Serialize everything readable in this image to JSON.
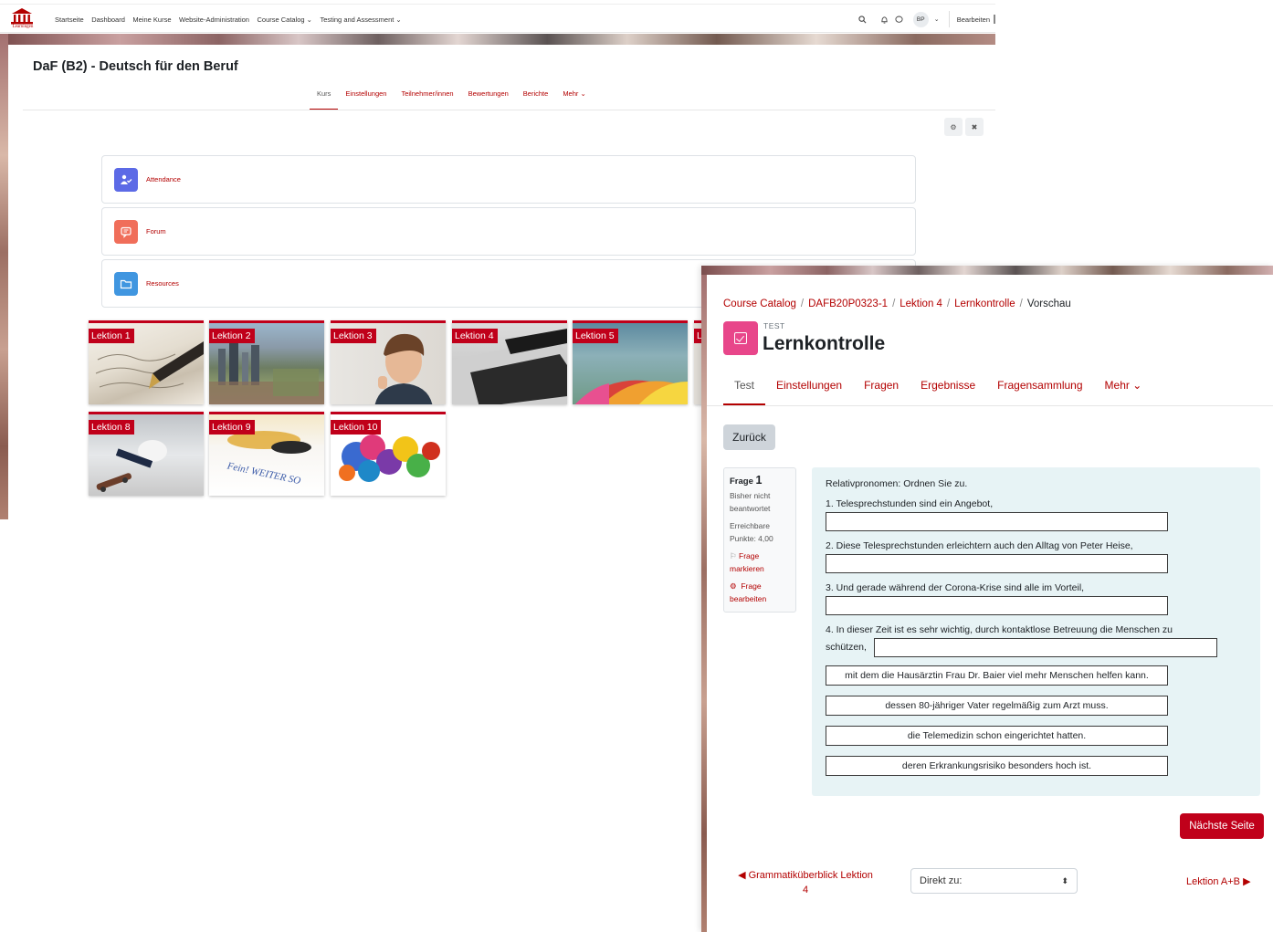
{
  "back_window": {
    "nav": {
      "logo_text": "Learningen",
      "links": [
        "Startseite",
        "Dashboard",
        "Meine Kurse",
        "Website-Administration",
        "Course Catalog ⌄",
        "Testing and Assessment ⌄"
      ],
      "avatar": "BP",
      "edit_label": "Bearbeiten"
    },
    "course_title": "DaF (B2) - Deutsch für den Beruf",
    "course_tabs": [
      "Kurs",
      "Einstellungen",
      "Teilnehmer/innen",
      "Bewertungen",
      "Berichte",
      "Mehr ⌄"
    ],
    "activities": [
      {
        "label": "Attendance",
        "icon": "attendance-icon",
        "color": "#5c6ae6"
      },
      {
        "label": "Forum",
        "icon": "forum-icon",
        "color": "#f06e5a"
      },
      {
        "label": "Resources",
        "icon": "folder-icon",
        "color": "#4096e0"
      }
    ],
    "lessons": [
      "Lektion 1",
      "Lektion 2",
      "Lektion 3",
      "Lektion 4",
      "Lektion 5",
      "Lektion 8",
      "Lektion 9",
      "Lektion 10"
    ],
    "tile_image_text": "Fein! WEITER SO"
  },
  "front_window": {
    "breadcrumb": [
      "Course Catalog",
      "DAFB20P0323-1",
      "Lektion 4",
      "Lernkontrolle",
      "Vorschau"
    ],
    "module_type": "TEST",
    "quiz_title": "Lernkontrolle",
    "quiz_tabs": [
      "Test",
      "Einstellungen",
      "Fragen",
      "Ergebnisse",
      "Fragensammlung",
      "Mehr ⌄"
    ],
    "back_button": "Zurück",
    "question_info": {
      "label": "Frage",
      "number": "1",
      "status": [
        "Bisher nicht",
        "beantwortet"
      ],
      "points": [
        "Erreichbare",
        "Punkte: 4,00"
      ],
      "flag": [
        "Frage",
        "markieren"
      ],
      "edit": [
        "Frage",
        "bearbeiten"
      ]
    },
    "question": {
      "prompt": "Relativpronomen: Ordnen Sie zu.",
      "items": [
        "1. Telesprechstunden sind ein Angebot,",
        "2. Diese Telesprechstunden erleichtern auch den Alltag von Peter Heise,",
        "3. Und gerade während der Corona-Krise sind alle im Vorteil,",
        "4. In dieser Zeit ist es sehr wichtig, durch kontaktlose Betreuung die Menschen zu",
        "schützen,"
      ],
      "options": [
        "mit dem die Hausärztin Frau Dr. Baier viel mehr Menschen helfen kann.",
        "dessen 80-jähriger Vater regelmäßig zum Arzt muss.",
        "die Telemedizin schon eingerichtet hatten.",
        "deren Erkrankungsrisiko besonders hoch ist."
      ]
    },
    "next_page_button": "Nächste Seite",
    "prev_link": [
      "◀ Grammatiküberblick Lektion",
      "4"
    ],
    "jump_select": "Direkt zu:",
    "next_link": "Lektion A+B ▶"
  },
  "colors": {
    "brand": "#b30000",
    "accent": "#c0001a",
    "quiz_icon": "#e8468a",
    "question_bg": "#e7f3f5"
  }
}
